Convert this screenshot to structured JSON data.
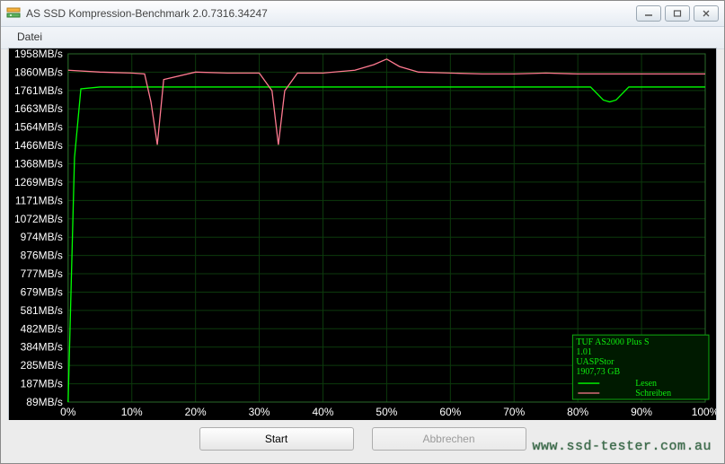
{
  "window": {
    "title": "AS SSD Kompression-Benchmark 2.0.7316.34247"
  },
  "menu": {
    "file": "Datei"
  },
  "buttons": {
    "start": "Start",
    "abort": "Abbrechen"
  },
  "legend": {
    "device": "TUF AS2000 Plus S",
    "fw": "1.01",
    "driver": "UASPStor",
    "size": "1907,73 GB",
    "read": "Lesen",
    "write": "Schreiben"
  },
  "watermark": "www.ssd-tester.com.au",
  "chart_data": {
    "type": "line",
    "xlabel": "",
    "ylabel": "",
    "xlim": [
      0,
      100
    ],
    "ylim": [
      89,
      1958
    ],
    "x_ticks": [
      "0%",
      "10%",
      "20%",
      "30%",
      "40%",
      "50%",
      "60%",
      "70%",
      "80%",
      "90%",
      "100%"
    ],
    "y_ticks": [
      "1958MB/s",
      "1860MB/s",
      "1761MB/s",
      "1663MB/s",
      "1564MB/s",
      "1466MB/s",
      "1368MB/s",
      "1269MB/s",
      "1171MB/s",
      "1072MB/s",
      "974MB/s",
      "876MB/s",
      "777MB/s",
      "679MB/s",
      "581MB/s",
      "482MB/s",
      "384MB/s",
      "285MB/s",
      "187MB/s",
      "89MB/s"
    ],
    "series": [
      {
        "name": "Lesen",
        "color": "#00ff00",
        "x": [
          0,
          1,
          2,
          5,
          10,
          15,
          20,
          25,
          30,
          35,
          40,
          45,
          50,
          55,
          60,
          65,
          70,
          75,
          80,
          82,
          84,
          85,
          86,
          88,
          90,
          95,
          100
        ],
        "y": [
          89,
          1400,
          1770,
          1780,
          1780,
          1780,
          1780,
          1780,
          1780,
          1780,
          1780,
          1780,
          1780,
          1780,
          1780,
          1780,
          1780,
          1780,
          1780,
          1780,
          1710,
          1700,
          1710,
          1780,
          1780,
          1780,
          1780
        ]
      },
      {
        "name": "Schreiben",
        "color": "#ff7a90",
        "x": [
          0,
          5,
          10,
          12,
          13,
          14,
          15,
          20,
          25,
          28,
          30,
          32,
          33,
          34,
          36,
          40,
          45,
          48,
          50,
          52,
          55,
          60,
          65,
          70,
          75,
          80,
          85,
          90,
          95,
          100
        ],
        "y": [
          1870,
          1860,
          1855,
          1850,
          1700,
          1470,
          1820,
          1860,
          1855,
          1855,
          1855,
          1760,
          1470,
          1760,
          1855,
          1855,
          1870,
          1900,
          1930,
          1890,
          1860,
          1855,
          1850,
          1850,
          1855,
          1850,
          1850,
          1850,
          1850,
          1850
        ]
      }
    ]
  }
}
